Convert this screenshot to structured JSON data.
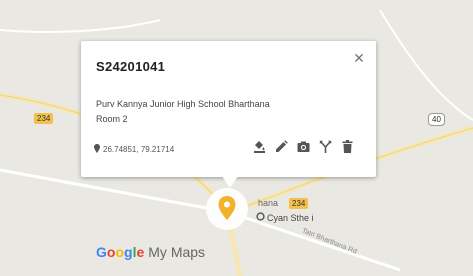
{
  "map": {
    "background": "#e9e8e3",
    "road_color": "#f6e7b3",
    "secondary_road_color": "#ffffff",
    "town_label": "hana",
    "road_shields": [
      {
        "id": "left",
        "text": "234",
        "style": "yellow"
      },
      {
        "id": "bottom",
        "text": "234",
        "style": "yellow"
      },
      {
        "id": "right",
        "text": "40",
        "style": "white"
      }
    ],
    "road_label": "Tatri Bharthana Rd",
    "poi": {
      "icon": "poi-circle-icon",
      "label": "Cyan Sthe i"
    }
  },
  "popup": {
    "title": "S24201041",
    "description_line1": "Purv Kannya Junior High School Bharthana",
    "description_line2": "Room 2",
    "coordinates": "26.74851, 79.21714",
    "close_icon": "close-icon",
    "actions": [
      {
        "name": "style-icon"
      },
      {
        "name": "edit-icon"
      },
      {
        "name": "camera-icon"
      },
      {
        "name": "directions-icon"
      },
      {
        "name": "delete-icon"
      }
    ]
  },
  "marker": {
    "icon": "map-pin-icon",
    "color": "#f2b32c"
  },
  "branding": {
    "google": "Google",
    "product": "My Maps"
  }
}
